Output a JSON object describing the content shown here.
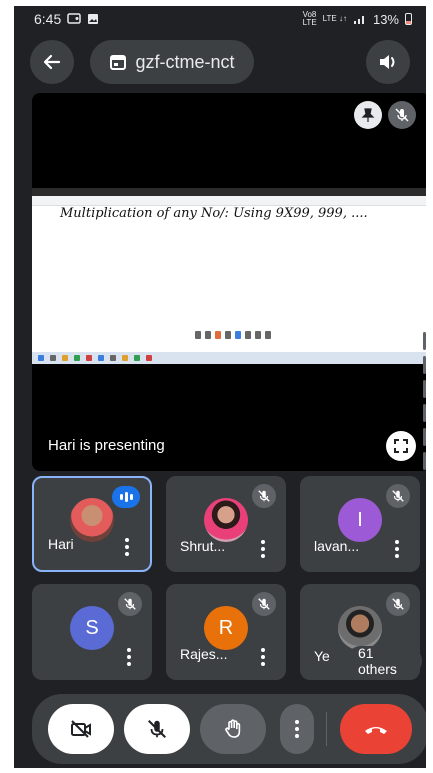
{
  "status_bar": {
    "time": "6:45",
    "network_top": "Vo8",
    "network_bottom": "LTE",
    "signal": "LTE ↓↑",
    "battery": "13%"
  },
  "top_bar": {
    "meeting_code": "gzf-ctme-nct"
  },
  "presentation": {
    "handwriting": "Multiplication of any No/: Using 9X99, 999, ....",
    "presenting_label": "Hari is presenting"
  },
  "participants": [
    {
      "name": "Hari",
      "avatar_type": "photo",
      "status": "speaking"
    },
    {
      "name": "Shrut...",
      "avatar_type": "photo",
      "status": "muted"
    },
    {
      "name": "lavan...",
      "avatar_initial": "I",
      "avatar_color": "#9c5ad6",
      "status": "muted"
    },
    {
      "name": "",
      "avatar_initial": "S",
      "avatar_color": "#5b6bd6",
      "status": "muted"
    },
    {
      "name": "Rajes...",
      "avatar_initial": "R",
      "avatar_color": "#e8710a",
      "status": "muted"
    },
    {
      "name": "Ye",
      "avatar_type": "photo",
      "status": "muted",
      "others_label": "61 others"
    }
  ],
  "colors": {
    "background": "#202124",
    "tile": "#3c4043",
    "active_border": "#8ab4f8",
    "leave": "#ea4335"
  },
  "controls": {
    "camera_icon": "camera-off-icon",
    "mic_icon": "mic-off-icon",
    "hand_icon": "raise-hand-icon",
    "more_icon": "more-vertical-icon",
    "leave_icon": "hang-up-icon"
  }
}
